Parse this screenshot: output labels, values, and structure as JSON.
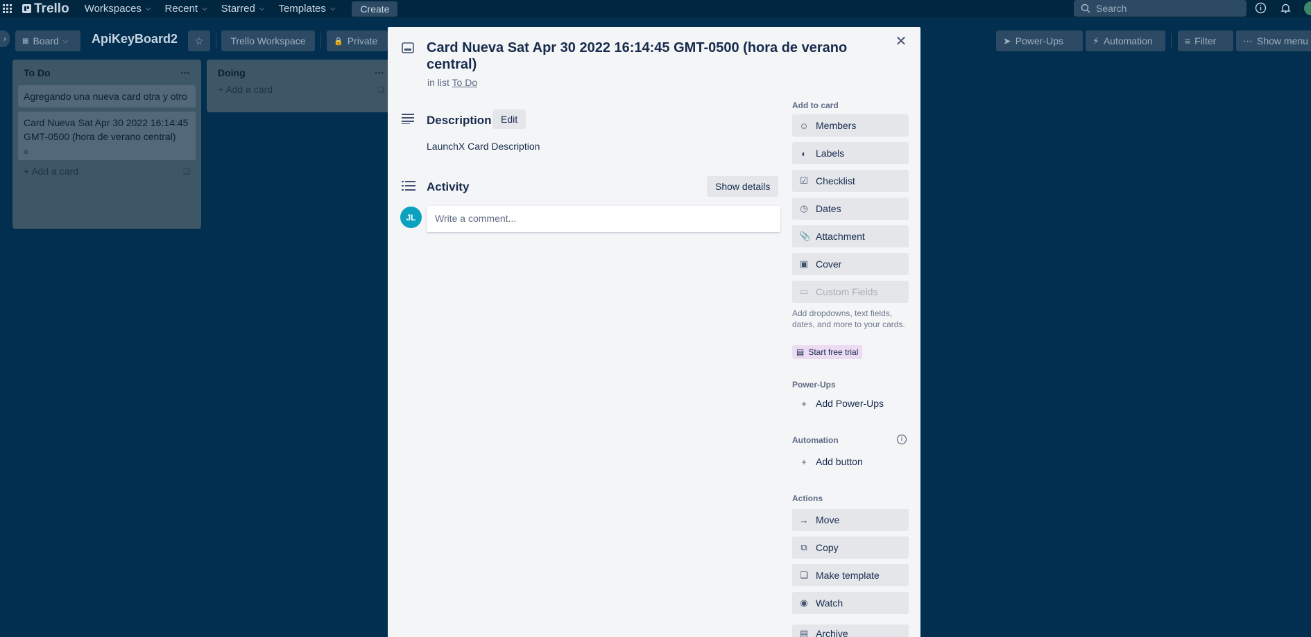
{
  "topnav": {
    "logo": "Trello",
    "items": [
      "Workspaces",
      "Recent",
      "Starred",
      "Templates"
    ],
    "create": "Create",
    "search_placeholder": "Search"
  },
  "board": {
    "view": "Board",
    "title": "ApiKeyBoard2",
    "workspace": "Trello Workspace",
    "visibility": "Private",
    "power_ups": "Power-Ups",
    "automation": "Automation",
    "filter": "Filter",
    "show_menu": "Show menu"
  },
  "lists": [
    {
      "title": "To Do",
      "cards": [
        "Agregando una nueva card otra y otro",
        "Card Nueva Sat Apr 30 2022 16:14:45 GMT-0500 (hora de verano central)"
      ],
      "add_card": "Add a card"
    },
    {
      "title": "Doing",
      "cards": [],
      "add_card": "Add a card"
    }
  ],
  "modal": {
    "title": "Card Nueva Sat Apr 30 2022 16:14:45 GMT-0500 (hora de verano central)",
    "in_list_prefix": "in list",
    "in_list_name": "To Do",
    "description_label": "Description",
    "edit": "Edit",
    "description": "LaunchX Card Description",
    "activity_label": "Activity",
    "show_details": "Show details",
    "avatar": "JL",
    "comment_placeholder": "Write a comment...",
    "sidebar": {
      "add_to_card": "Add to card",
      "add_buttons": [
        "Members",
        "Labels",
        "Checklist",
        "Dates",
        "Attachment",
        "Cover",
        "Custom Fields"
      ],
      "custom_fields_note": "Add dropdowns, text fields, dates, and more to your cards.",
      "trial": "Start free trial",
      "power_ups_label": "Power-Ups",
      "add_power_ups": "Add Power-Ups",
      "automation_label": "Automation",
      "add_button": "Add button",
      "actions_label": "Actions",
      "actions": [
        "Move",
        "Copy",
        "Make template",
        "Watch",
        "Archive"
      ]
    }
  }
}
